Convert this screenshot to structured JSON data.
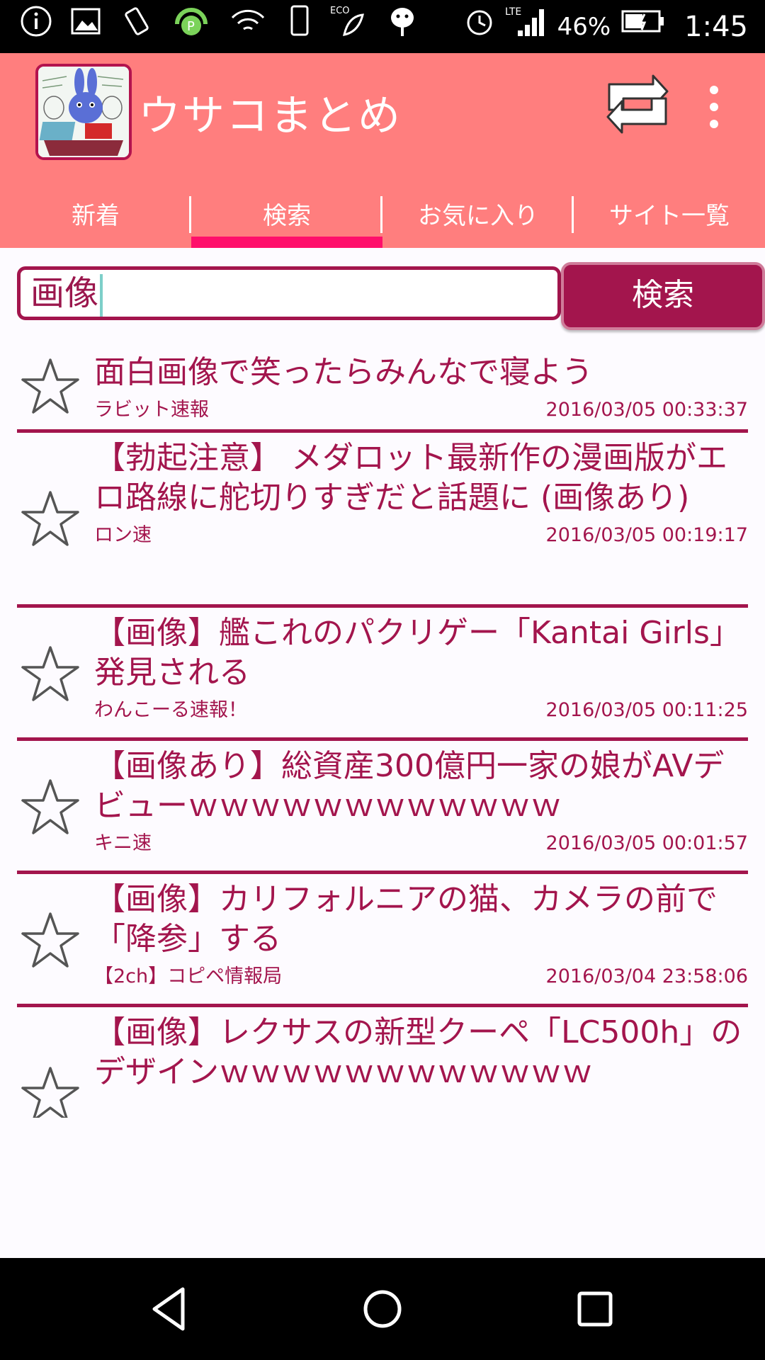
{
  "status_bar": {
    "battery": "46%",
    "network": "LTE",
    "clock": "1:45",
    "eco_label": "ECO",
    "icons": [
      "info-icon",
      "image-icon",
      "vibrate-icon",
      "headset-icon",
      "wifi-icon",
      "phone-icon",
      "eco-icon",
      "android-icon",
      "alarm-icon",
      "signal-icon",
      "battery-icon"
    ]
  },
  "app_bar": {
    "title": "ウサコまとめ",
    "colors": {
      "bar": "#ff7e7e",
      "accent": "#a3154d",
      "indicator": "#ff0f6b"
    }
  },
  "tabs": [
    {
      "label": "新着",
      "active": false
    },
    {
      "label": "検索",
      "active": true
    },
    {
      "label": "お気に入り",
      "active": false
    },
    {
      "label": "サイト一覧",
      "active": false
    }
  ],
  "search": {
    "value": "画像",
    "button_label": "検索"
  },
  "results": [
    {
      "title": "面白画像で笑ったらみんなで寝よう",
      "source": "ラビット速報",
      "timestamp": "2016/03/05 00:33:37"
    },
    {
      "title": "【勃起注意】 メダロット最新作の漫画版がエロ路線に舵切りすぎだと話題に (画像あり)",
      "source": "ロン速",
      "timestamp": "2016/03/05 00:19:17"
    },
    {
      "title": "【画像】艦これのパクリゲー「Kantai Girls」発見される",
      "source": "わんこーる速報！",
      "timestamp": "2016/03/05 00:11:25"
    },
    {
      "title": "【画像あり】総資産300億円一家の娘がAVデビューｗｗｗｗｗｗｗｗｗｗｗｗ",
      "source": "キニ速",
      "timestamp": "2016/03/05 00:01:57"
    },
    {
      "title": "【画像】カリフォルニアの猫、カメラの前で「降参」する",
      "source": "【2ch】コピペ情報局",
      "timestamp": "2016/03/04 23:58:06"
    },
    {
      "title": "【画像】レクサスの新型クーペ「LC500h」のデザインｗｗｗｗｗｗｗｗｗｗｗｗ",
      "source": "",
      "timestamp": ""
    }
  ]
}
